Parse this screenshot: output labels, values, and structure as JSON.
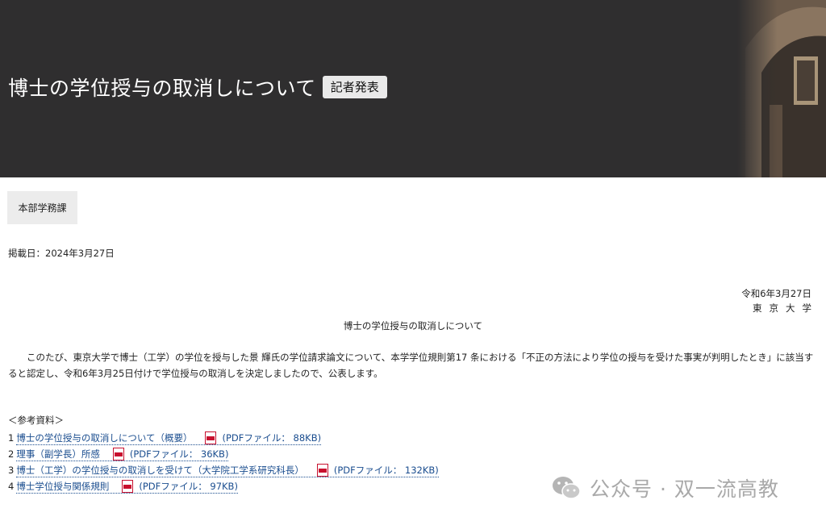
{
  "header": {
    "title": "博士の学位授与の取消しについて",
    "badge": "記者発表",
    "background_color": "#2f2e2f"
  },
  "meta": {
    "department": "本部学務課",
    "posted": "掲載日：2024年3月27日"
  },
  "notice": {
    "date": "令和6年3月27日",
    "organization": "東京大学",
    "title": "博士の学位授与の取消しについて",
    "body": "このたび、東京大学で博士（工学）の学位を授与した景 輝氏の学位請求論文について、本学学位規則第17 条における「不正の方法により学位の授与を受けた事実が判明したとき」に該当すると認定し、令和6年3月25日付けで学位授与の取消しを決定しましたので、公表します。"
  },
  "references": {
    "heading": "＜参考資料＞",
    "items": [
      {
        "number": "1",
        "label": "博士の学位授与の取消しについて（概要）",
        "size": "(PDFファイル： 88KB)"
      },
      {
        "number": "2",
        "label": "理事（副学長）所感",
        "size": "(PDFファイル： 36KB)"
      },
      {
        "number": "3",
        "label": "博士（工学）の学位授与の取消しを受けて（大学院工学系研究科長）",
        "size": "(PDFファイル： 132KB)"
      },
      {
        "number": "4",
        "label": "博士学位授与関係規則",
        "size": "(PDFファイル： 97KB)"
      }
    ],
    "pdf_icon_label": "PDF",
    "link_color": "#1a4d8f"
  },
  "watermark": {
    "text": "公众号 · 双一流高教",
    "icon": "wechat-icon"
  }
}
